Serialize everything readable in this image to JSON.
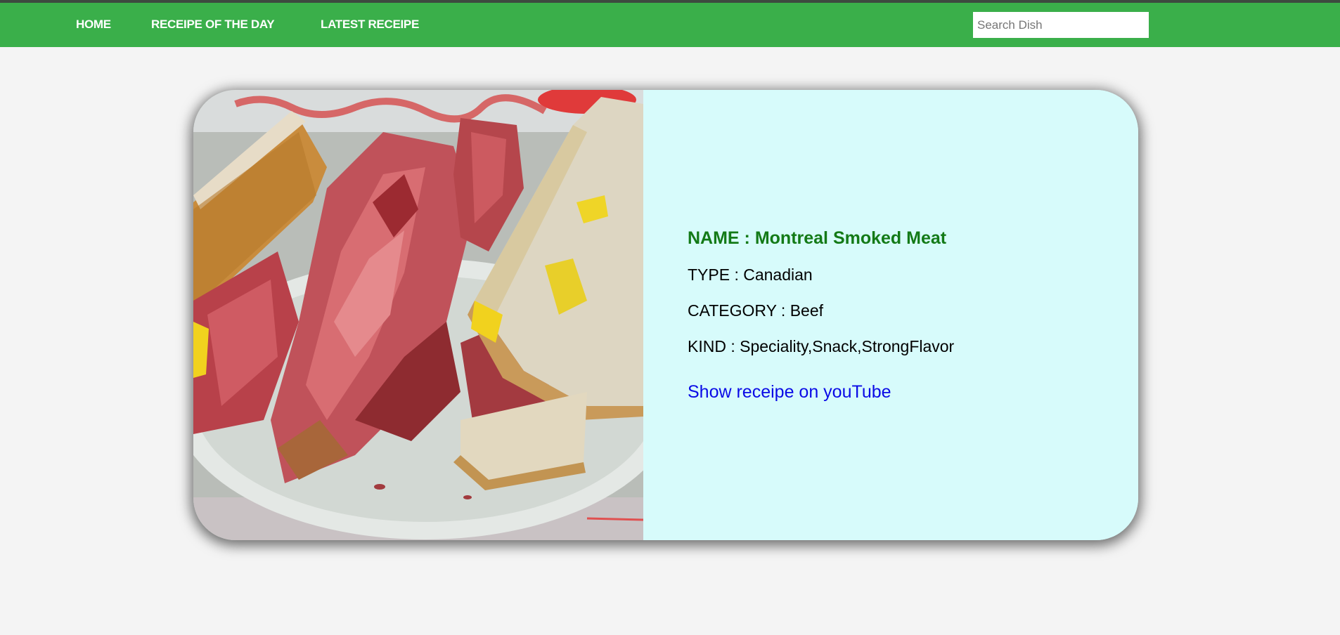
{
  "nav": {
    "home": "HOME",
    "recipe_of_the_day": "RECEIPE OF THE DAY",
    "latest_recipe": "LATEST RECEIPE"
  },
  "search": {
    "placeholder": "Search Dish",
    "value": ""
  },
  "dish": {
    "name": "NAME : Montreal Smoked Meat",
    "type": "TYPE : Canadian",
    "category": "CATEGORY : Beef",
    "kind": "KIND : Speciality,Snack,StrongFlavor",
    "youtube_link": "Show receipe on youTube",
    "image_icon": "dish-photo"
  },
  "colors": {
    "navbar": "#3aaf4a",
    "card_info_bg": "#d7fbfb",
    "dish_name": "#137a17",
    "link": "#0a0ae6",
    "page_bg": "#f4f4f4"
  }
}
